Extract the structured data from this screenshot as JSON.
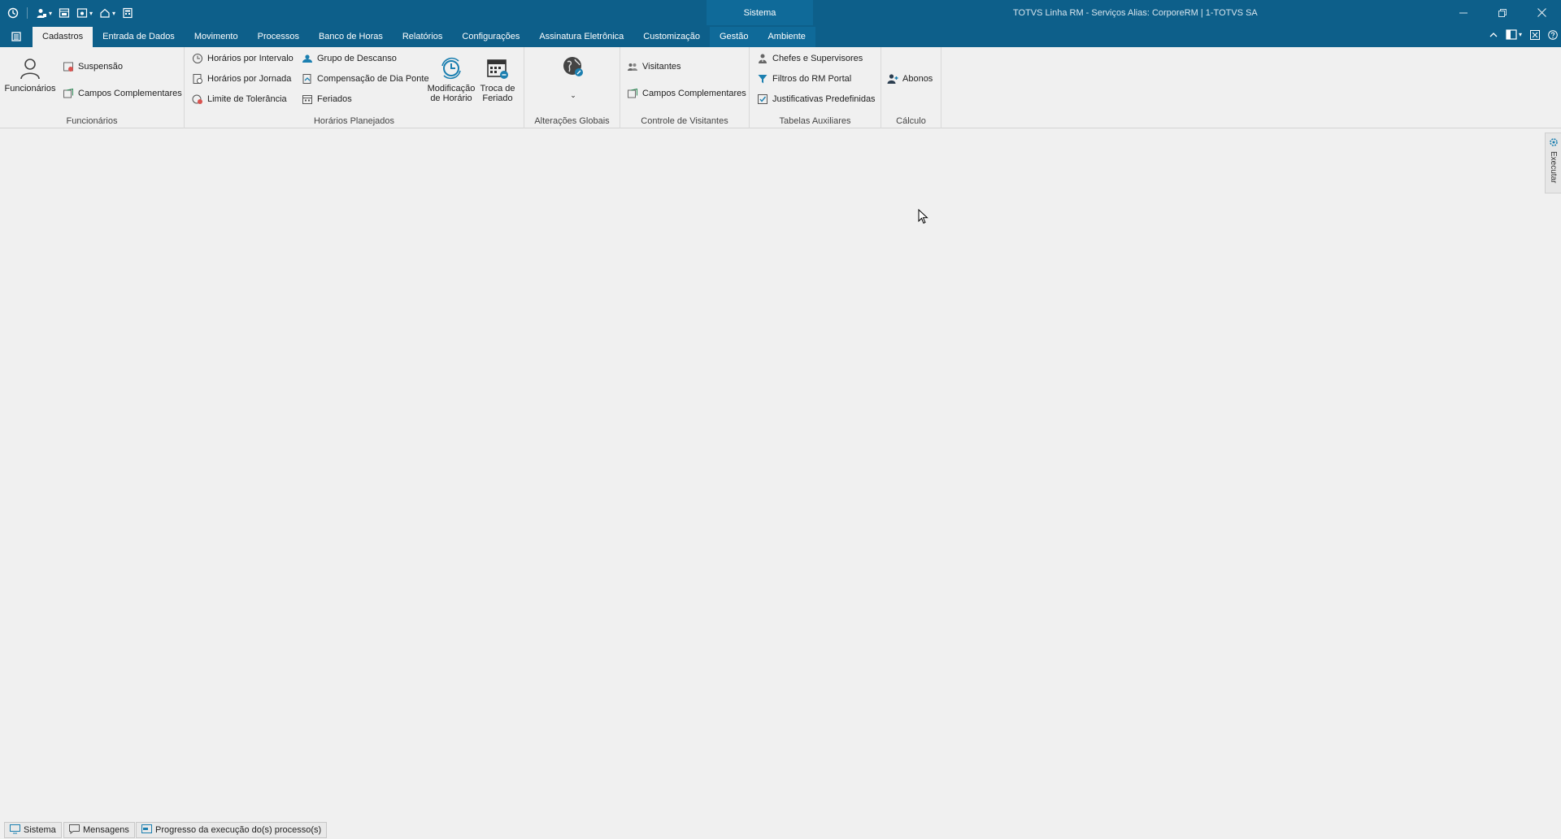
{
  "titlebar": {
    "context_label": "Sistema",
    "app_title": "TOTVS Linha RM - Serviços  Alias: CorporeRM | 1-TOTVS SA"
  },
  "tabs": [
    {
      "label": "Cadastros",
      "active": true
    },
    {
      "label": "Entrada de Dados"
    },
    {
      "label": "Movimento"
    },
    {
      "label": "Processos"
    },
    {
      "label": "Banco de Horas"
    },
    {
      "label": "Relatórios"
    },
    {
      "label": "Configurações"
    },
    {
      "label": "Assinatura Eletrônica"
    },
    {
      "label": "Customização"
    },
    {
      "label": "Gestão"
    },
    {
      "label": "Ambiente"
    }
  ],
  "ribbon": {
    "funcionarios": {
      "label": "Funcionários",
      "funcionarios_btn": "Funcionários",
      "suspensao": "Suspensão",
      "campos_complementares": "Campos Complementares"
    },
    "horarios": {
      "label": "Horários Planejados",
      "horarios_intervalo": "Horários por Intervalo",
      "horarios_jornada": "Horários por Jornada",
      "limite_tolerancia": "Limite de Tolerância",
      "grupo_descanso": "Grupo de Descanso",
      "compensacao": "Compensação de Dia Ponte",
      "feriados": "Feriados",
      "modificacao_l1": "Modificação",
      "modificacao_l2": "de Horário",
      "troca_l1": "Troca de",
      "troca_l2": "Feriado"
    },
    "alteracoes": {
      "label": "Alterações Globais"
    },
    "visitantes": {
      "label": "Controle de Visitantes",
      "visitantes": "Visitantes",
      "campos_complementares": "Campos Complementares"
    },
    "tabelas": {
      "label": "Tabelas Auxiliares",
      "chefes": "Chefes e Supervisores",
      "filtros": "Filtros do RM Portal",
      "justificativas": "Justificativas Predefinidas"
    },
    "calculo": {
      "label": "Cálculo",
      "abonos": "Abonos"
    }
  },
  "side_panel": {
    "label": "Executar"
  },
  "statusbar": {
    "sistema": "Sistema",
    "mensagens": "Mensagens",
    "progresso": "Progresso da execução do(s) processo(s)"
  },
  "colors": {
    "brand": "#0d5f8a",
    "context": "#0f6a99",
    "accent_icon": "#1b7fb0"
  }
}
